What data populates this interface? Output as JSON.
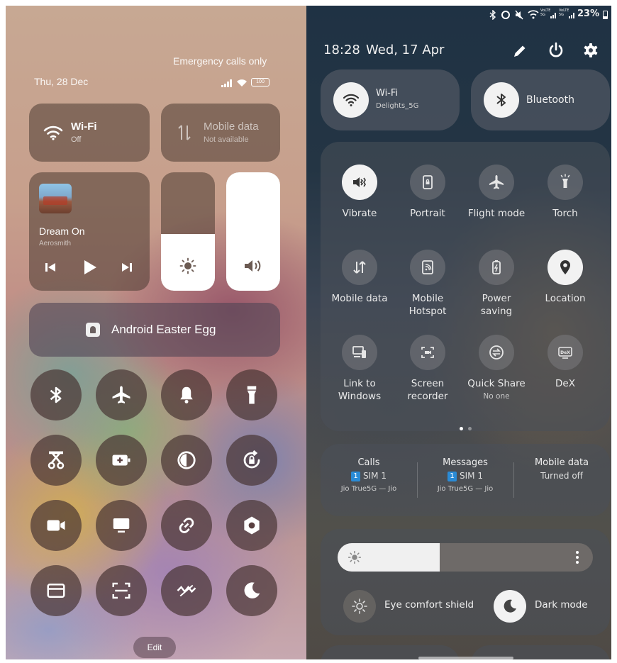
{
  "left_panel": {
    "status": {
      "emergency_text": "Emergency calls only",
      "date": "Thu, 28 Dec",
      "battery": "100"
    },
    "wifi_tile": {
      "title": "Wi-Fi",
      "status": "Off"
    },
    "mobile_data_tile": {
      "title": "Mobile data",
      "status": "Not available"
    },
    "media": {
      "song": "Dream On",
      "artist": "Aerosmith"
    },
    "sliders": {
      "brightness_level": 0.48,
      "volume_level": 1.0
    },
    "easter_egg_label": "Android Easter Egg",
    "toggles_row1": [
      "bluetooth-icon",
      "airplane-icon",
      "bell-icon",
      "flashlight-icon"
    ],
    "toggles_row2": [
      "screen-cast-icon",
      "battery-saver-icon",
      "contrast-icon",
      "rotation-lock-icon"
    ],
    "toggles_row3": [
      "video-camera-icon",
      "monitor-icon",
      "link-icon",
      "settings-hex-icon"
    ],
    "toggles_row4": [
      "card-icon",
      "scan-icon",
      "wave-off-icon",
      "moon-icon"
    ],
    "edit_label": "Edit"
  },
  "right_panel": {
    "status": {
      "battery_percent": "23%",
      "network_labels": [
        "VoLTE 5G",
        "VoLTE 5G"
      ]
    },
    "header": {
      "time": "18:28",
      "date": "Wed, 17 Apr"
    },
    "wifi": {
      "title": "Wi-Fi",
      "network": "Delights_5G"
    },
    "bluetooth": {
      "title": "Bluetooth"
    },
    "quick_settings": [
      {
        "label": "Vibrate",
        "sub": "",
        "icon": "vibrate-icon",
        "active": true
      },
      {
        "label": "Portrait",
        "sub": "",
        "icon": "portrait-lock-icon",
        "active": false
      },
      {
        "label": "Flight mode",
        "sub": "",
        "icon": "airplane-icon",
        "active": false
      },
      {
        "label": "Torch",
        "sub": "",
        "icon": "torch-icon",
        "active": false
      },
      {
        "label": "Mobile data",
        "sub": "",
        "icon": "data-arrows-icon",
        "active": false
      },
      {
        "label": "Mobile Hotspot",
        "sub": "",
        "icon": "hotspot-icon",
        "active": false
      },
      {
        "label": "Power saving",
        "sub": "",
        "icon": "power-saving-icon",
        "active": false
      },
      {
        "label": "Location",
        "sub": "",
        "icon": "location-pin-icon",
        "active": true
      },
      {
        "label": "Link to Windows",
        "sub": "",
        "icon": "link-windows-icon",
        "active": false
      },
      {
        "label": "Screen recorder",
        "sub": "",
        "icon": "screen-recorder-icon",
        "active": false
      },
      {
        "label": "Quick Share",
        "sub": "No one",
        "icon": "quick-share-icon",
        "active": false
      },
      {
        "label": "DeX",
        "sub": "",
        "icon": "dex-icon",
        "active": false
      }
    ],
    "sim": {
      "calls": {
        "title": "Calls",
        "badge": "1",
        "sim": "SIM 1",
        "carrier": "Jio True5G — Jio"
      },
      "messages": {
        "title": "Messages",
        "badge": "1",
        "sim": "SIM 1",
        "carrier": "Jio True5G — Jio"
      },
      "mobile_data": {
        "title": "Mobile data",
        "status": "Turned off"
      }
    },
    "brightness_level": 0.4,
    "eye_comfort_label": "Eye comfort shield",
    "dark_mode_label": "Dark mode",
    "colors": {
      "sim_badge": "#2a8bd6",
      "active_tile": "#f2f2f2"
    }
  }
}
